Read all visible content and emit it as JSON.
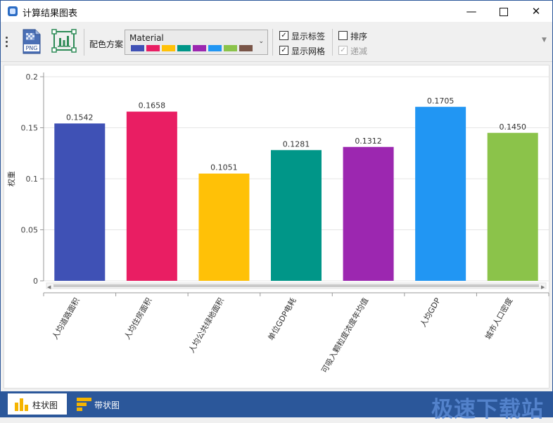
{
  "window": {
    "title": "计算结果图表"
  },
  "toolbar": {
    "png_label": "PNG",
    "scheme_label": "配色方案",
    "scheme_value": "Material",
    "scheme_colors": [
      "#3F51B5",
      "#E91E63",
      "#FFC107",
      "#009688",
      "#9C27B0",
      "#2196F3",
      "#8BC34A",
      "#795548"
    ],
    "show_labels": {
      "label": "显示标签",
      "checked": true
    },
    "show_grid": {
      "label": "显示网格",
      "checked": true
    },
    "sort": {
      "label": "排序",
      "checked": false
    },
    "descending": {
      "label": "递减",
      "checked": true,
      "disabled": true
    }
  },
  "chart_data": {
    "type": "bar",
    "ylabel": "权重",
    "ylim": [
      0,
      0.2
    ],
    "yticks": [
      "0",
      "0.05",
      "0.1",
      "0.15",
      "0.2"
    ],
    "grid": true,
    "categories": [
      "人均道路面积",
      "人均住房面积",
      "人均公共绿地面积",
      "单位GDP电耗",
      "可吸入颗粒度浓度年均值",
      "人均GDP",
      "城市人口密度"
    ],
    "values": [
      0.1542,
      0.1658,
      0.1051,
      0.1281,
      0.1312,
      0.1705,
      0.145
    ],
    "value_labels": [
      "0.1542",
      "0.1658",
      "0.1051",
      "0.1281",
      "0.1312",
      "0.1705",
      "0.1450"
    ],
    "colors": [
      "#3F51B5",
      "#E91E63",
      "#FFC107",
      "#009688",
      "#9C27B0",
      "#2196F3",
      "#8BC34A"
    ]
  },
  "bottom_tabs": [
    {
      "label": "柱状图",
      "active": true
    },
    {
      "label": "带状图",
      "active": false
    }
  ],
  "watermark": "极速下载站"
}
